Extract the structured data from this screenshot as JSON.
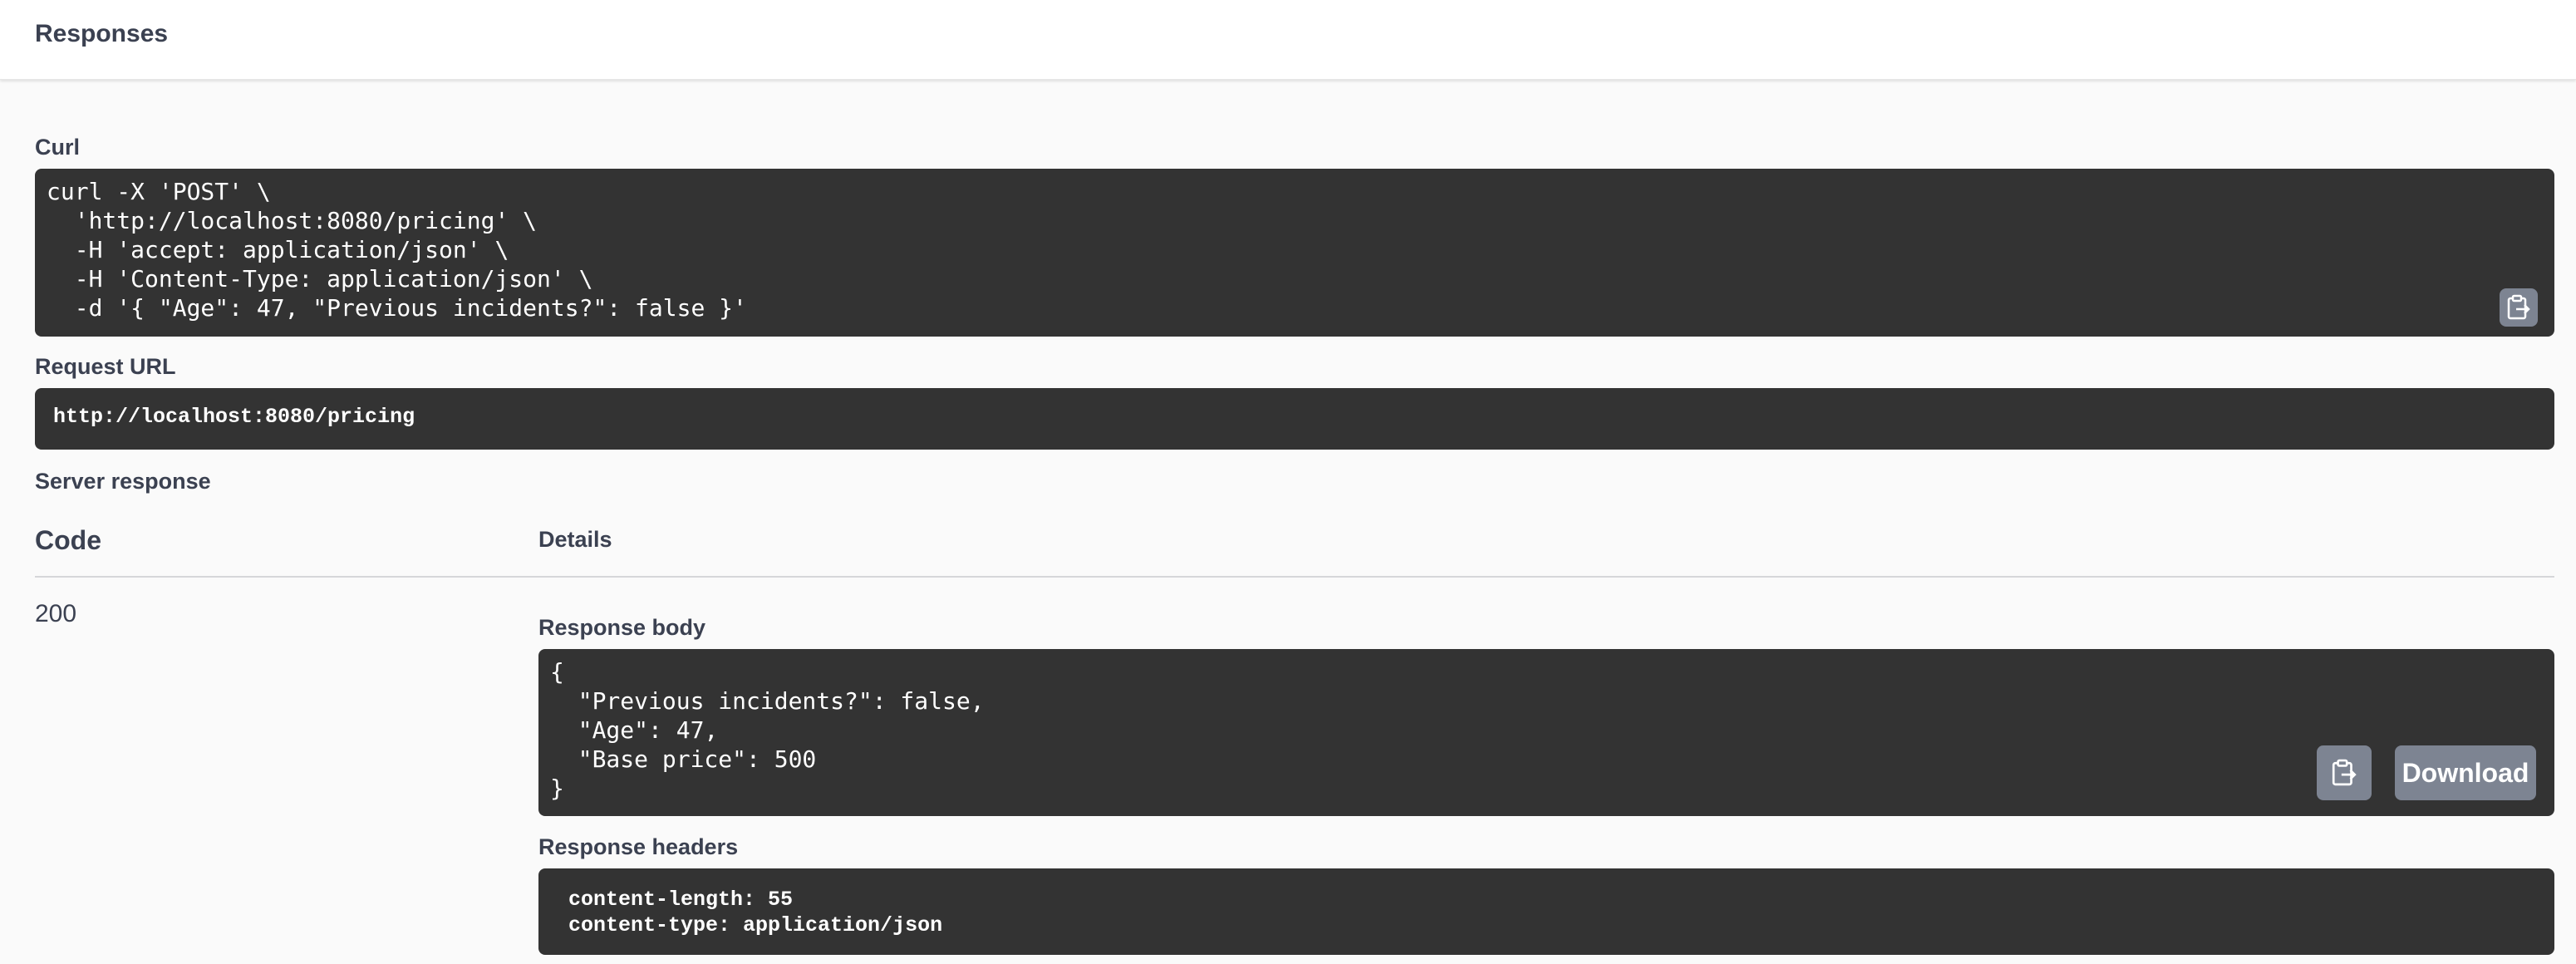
{
  "header": {
    "title": "Responses"
  },
  "curl": {
    "label": "Curl",
    "command": "curl -X 'POST' \\\n  'http://localhost:8080/pricing' \\\n  -H 'accept: application/json' \\\n  -H 'Content-Type: application/json' \\\n  -d '{ \"Age\": 47, \"Previous incidents?\": false }'"
  },
  "request_url": {
    "label": "Request URL",
    "value": "http://localhost:8080/pricing"
  },
  "server_response": {
    "label": "Server response",
    "code_header": "Code",
    "details_header": "Details",
    "code": "200",
    "response_body_label": "Response body",
    "response_body": "{\n  \"Previous incidents?\": false,\n  \"Age\": 47,\n  \"Base price\": 500\n}",
    "download_label": "Download",
    "response_headers_label": "Response headers",
    "response_headers": "content-length: 55\ncontent-type: application/json"
  },
  "icons": {
    "copy": "clipboard-copy-icon"
  },
  "colors": {
    "code_background": "#333333",
    "button_background": "#7d8492",
    "text": "#3b4151"
  }
}
